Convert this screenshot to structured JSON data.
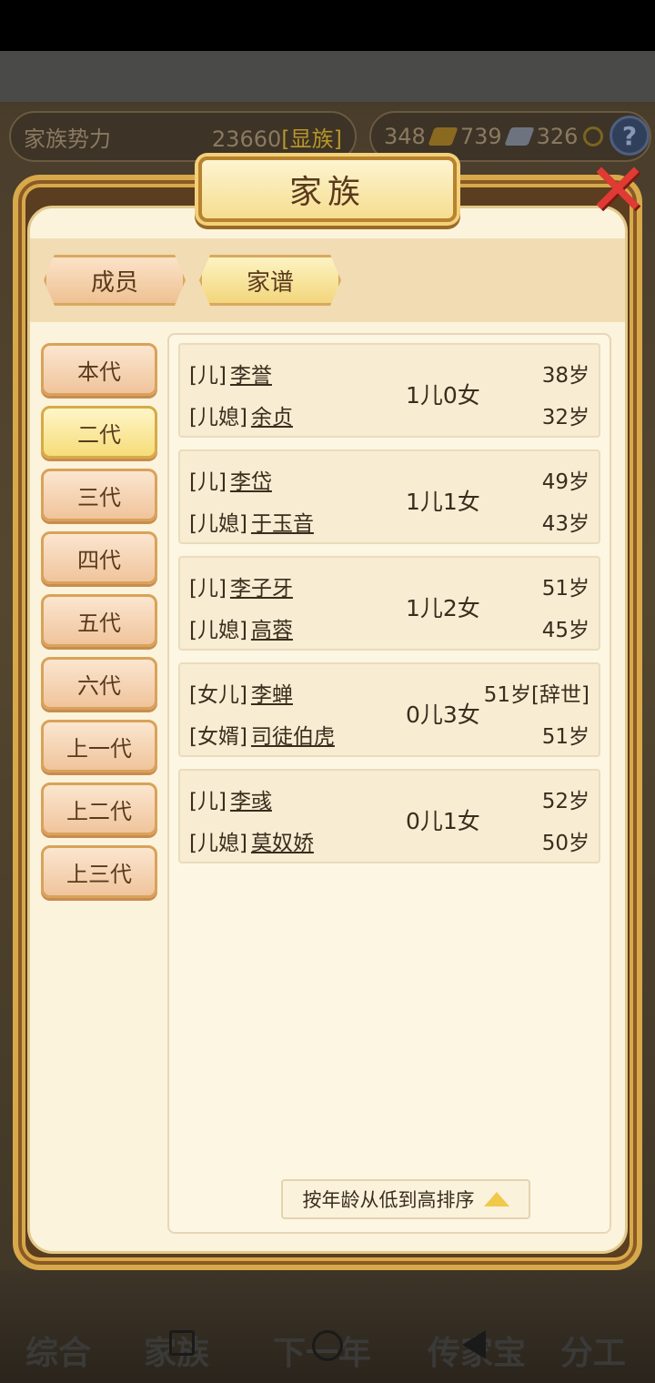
{
  "hud": {
    "power_label": "家族势力",
    "power_value": "23660",
    "power_tag": "[显族]",
    "gold": "348",
    "silver": "739",
    "coins": "326",
    "help": "?"
  },
  "dialog": {
    "title": "家族",
    "close": "✕"
  },
  "tabs": {
    "members": "成员",
    "tree": "家谱"
  },
  "generations": [
    "本代",
    "二代",
    "三代",
    "四代",
    "五代",
    "六代",
    "上一代",
    "上二代",
    "上三代"
  ],
  "active_generation": "二代",
  "families": [
    {
      "role1": "[儿]",
      "name1": "李誉",
      "age1": "38岁",
      "role2": "[儿媳]",
      "name2": "余贞",
      "age2": "32岁",
      "children": "1儿0女"
    },
    {
      "role1": "[儿]",
      "name1": "李岱",
      "age1": "49岁",
      "role2": "[儿媳]",
      "name2": "于玉音",
      "age2": "43岁",
      "children": "1儿1女"
    },
    {
      "role1": "[儿]",
      "name1": "李子牙",
      "age1": "51岁",
      "role2": "[儿媳]",
      "name2": "高蓉",
      "age2": "45岁",
      "children": "1儿2女"
    },
    {
      "role1": "[女儿]",
      "name1": "李蝉",
      "age1": "51岁[辞世]",
      "role2": "[女婿]",
      "name2": "司徒伯虎",
      "age2": "51岁",
      "children": "0儿3女"
    },
    {
      "role1": "[儿]",
      "name1": "李彧",
      "age1": "52岁",
      "role2": "[儿媳]",
      "name2": "莫奴娇",
      "age2": "50岁",
      "children": "0儿1女"
    }
  ],
  "sort": {
    "label": "按年龄从低到高排序"
  },
  "bottom_nav": [
    "综合",
    "家族",
    "下一年",
    "传家宝",
    "分工"
  ]
}
